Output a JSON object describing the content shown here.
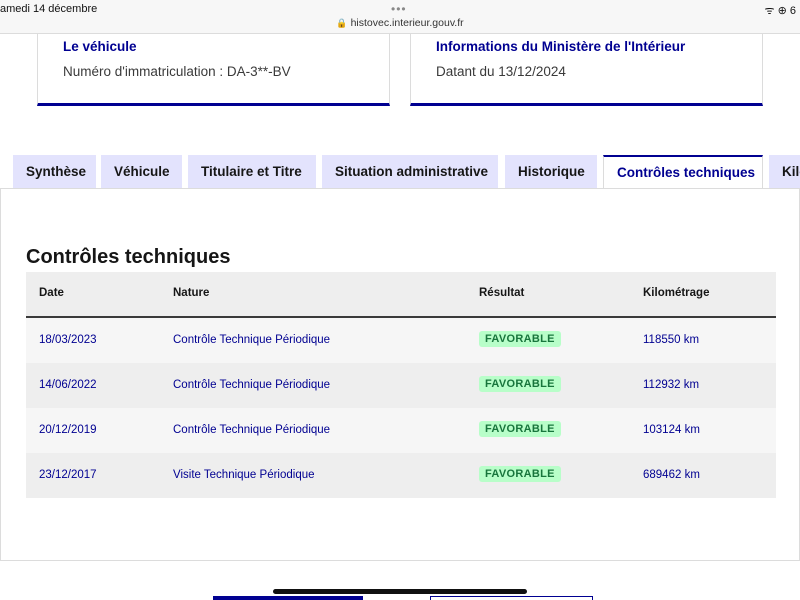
{
  "statusbar": {
    "date": "amedi 14 décembre",
    "url": "histovec.interieur.gouv.fr",
    "dots": "•••",
    "icons": "ᯤ ⊕ 6"
  },
  "cards": {
    "vehicle": {
      "title": "Le véhicule",
      "text": "Numéro d'immatriculation : DA-3**-BV"
    },
    "ministry": {
      "title": "Informations du Ministère de l'Intérieur",
      "text": "Datant du 13/12/2024"
    }
  },
  "tabs": [
    {
      "label": "Synthèse"
    },
    {
      "label": "Véhicule"
    },
    {
      "label": "Titulaire et Titre"
    },
    {
      "label": "Situation administrative"
    },
    {
      "label": "Historique"
    },
    {
      "label": "Contrôles techniques"
    },
    {
      "label": "Kilo"
    }
  ],
  "section": {
    "title": "Contrôles techniques"
  },
  "table": {
    "headers": {
      "date": "Date",
      "nature": "Nature",
      "result": "Résultat",
      "km": "Kilométrage"
    },
    "rows": [
      {
        "date": "18/03/2023",
        "nature": "Contrôle Technique Périodique",
        "result": "FAVORABLE",
        "km": "118550 km"
      },
      {
        "date": "14/06/2022",
        "nature": "Contrôle Technique Périodique",
        "result": "FAVORABLE",
        "km": "112932 km"
      },
      {
        "date": "20/12/2019",
        "nature": "Contrôle Technique Périodique",
        "result": "FAVORABLE",
        "km": "103124 km"
      },
      {
        "date": "23/12/2017",
        "nature": "Visite Technique Périodique",
        "result": "FAVORABLE",
        "km": "689462 km"
      }
    ]
  },
  "colors": {
    "accent": "#000091",
    "tab_bg": "#e3e3fd",
    "badge_bg": "#b8fec9",
    "badge_text": "#18753c"
  }
}
